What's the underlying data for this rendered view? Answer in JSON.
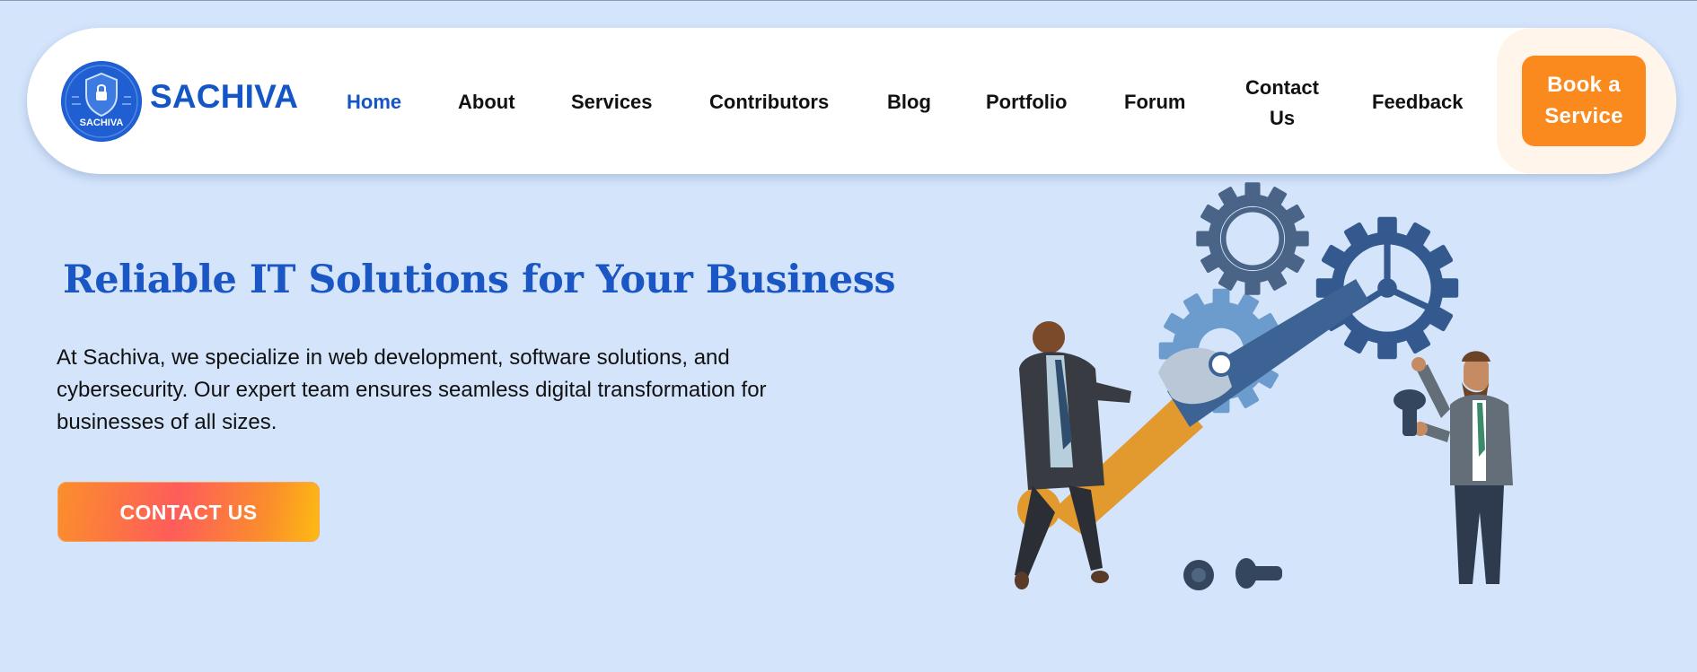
{
  "brand": {
    "name": "SACHIVA",
    "logo_text": "SACHIVA"
  },
  "nav": {
    "items": [
      "Home",
      "About",
      "Services",
      "Contributors",
      "Blog",
      "Portfolio",
      "Forum"
    ],
    "contact": [
      "Contact",
      "Us"
    ],
    "feedback": "Feedback",
    "active": "Home",
    "cta": [
      "Book a",
      "Service"
    ]
  },
  "hero": {
    "title": "Reliable IT Solutions for Your Business",
    "description_lines": [
      "At Sachiva, we specialize in web development, software solutions, and",
      "cybersecurity. Our expert team ensures seamless digital transformation for",
      "businesses of all sizes."
    ],
    "cta": "CONTACT US"
  },
  "colors": {
    "background": "#d3e4fb",
    "brand_blue": "#1456c6",
    "book_orange": "#fb8a1e",
    "cta_gradient": [
      "#fb8f2b",
      "#fe5c5a",
      "#fdbb12"
    ]
  },
  "icons": [
    "shield-logo-icon",
    "gears-illustration",
    "wrench-illustration",
    "screw-icon"
  ]
}
